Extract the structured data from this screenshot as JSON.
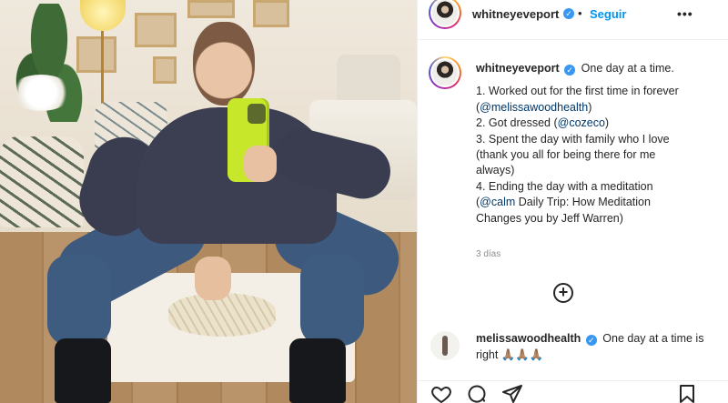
{
  "post": {
    "author": "whitneyeveport",
    "dot": "•",
    "follow_label": "Seguir",
    "more_label": "•••",
    "caption_first": "One day at a time.",
    "caption_lines": [
      "1. Worked out for the first time in forever",
      "(@melissawoodhealth)",
      "2. Got dressed (@cozeco)",
      "3. Spent the day with family who I love",
      "(thank you all for being there for me",
      "always)",
      "4. Ending the day with a meditation",
      "(@calm Daily Trip: How Meditation",
      "Changes you by Jeff Warren)"
    ],
    "mentions": {
      "melissa": "@melissawoodhealth",
      "cozeco": "@cozeco",
      "calm": "@calm"
    },
    "time_ago": "3 días"
  },
  "comment": {
    "author": "melissawoodhealth",
    "text": "One day at a time is right 🙏🏽🙏🏽🙏🏽"
  },
  "icons": {
    "verified": "verified-badge-icon",
    "add_comment": "plus-circle-icon",
    "like": "heart-icon",
    "comment": "comment-bubble-icon",
    "share": "paper-plane-icon",
    "save": "bookmark-icon"
  },
  "colors": {
    "accent_blue": "#0095f6",
    "verified_blue": "#3897f0",
    "mention_blue": "#00376b",
    "phone_lime": "#c7e82a"
  }
}
